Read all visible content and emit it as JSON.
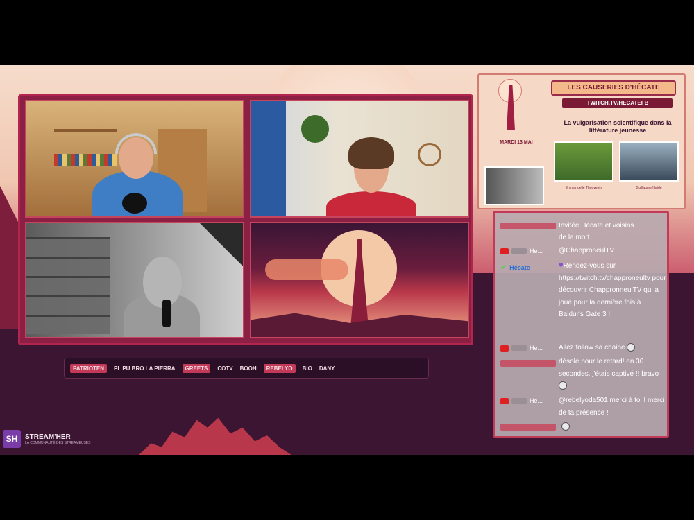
{
  "promo": {
    "title": "LES CAUSERIES D'HÉCATE",
    "twitch": "TWITCH.TV/HECATEFB",
    "topic": "La vulgarisation scientifique dans la littérature jeunesse",
    "date": "MARDI 13 MAI",
    "guest1_caption": "Emmanuelle Thouvenin",
    "guest2_caption": "Guillaume Haïdé"
  },
  "ticker": {
    "items": [
      "PATRIOTEN",
      "PL PU BRO LA PIERRA",
      "GREETS",
      "COTV",
      "BOOH",
      "REBELYO",
      "BIO",
      "DANY"
    ]
  },
  "brand": {
    "logo": "SH",
    "name": "STREAM'HER",
    "tagline": "LA COMMUNAUTÉ DES STREAMEUSES"
  },
  "chat": {
    "messages": [
      {
        "text": "Invitée Hécate et voisins"
      },
      {
        "text": "de la mort"
      },
      {
        "meta": "He...",
        "text": "@ChapproneulTV"
      },
      {
        "meta": "Hécate",
        "text": "Rendez-vous sur https://twitch.tv/chapproneultv pour découvrir ChappronneulTV qui a joué pour la dernière fois à Baldur's Gate 3 !"
      },
      {
        "meta": "He...",
        "text": "Allez follow sa chaine"
      },
      {
        "text": "désolé pour le retard! en 30 secondes, j'étais captivé !! bravo"
      },
      {
        "meta": "He...",
        "text": "@rebelyoda501 merci à toi ! merci de ta présence !"
      }
    ]
  },
  "colors": {
    "accent": "#c23a57",
    "frame": "#8c1f44",
    "bg_dark": "#3b1531"
  }
}
